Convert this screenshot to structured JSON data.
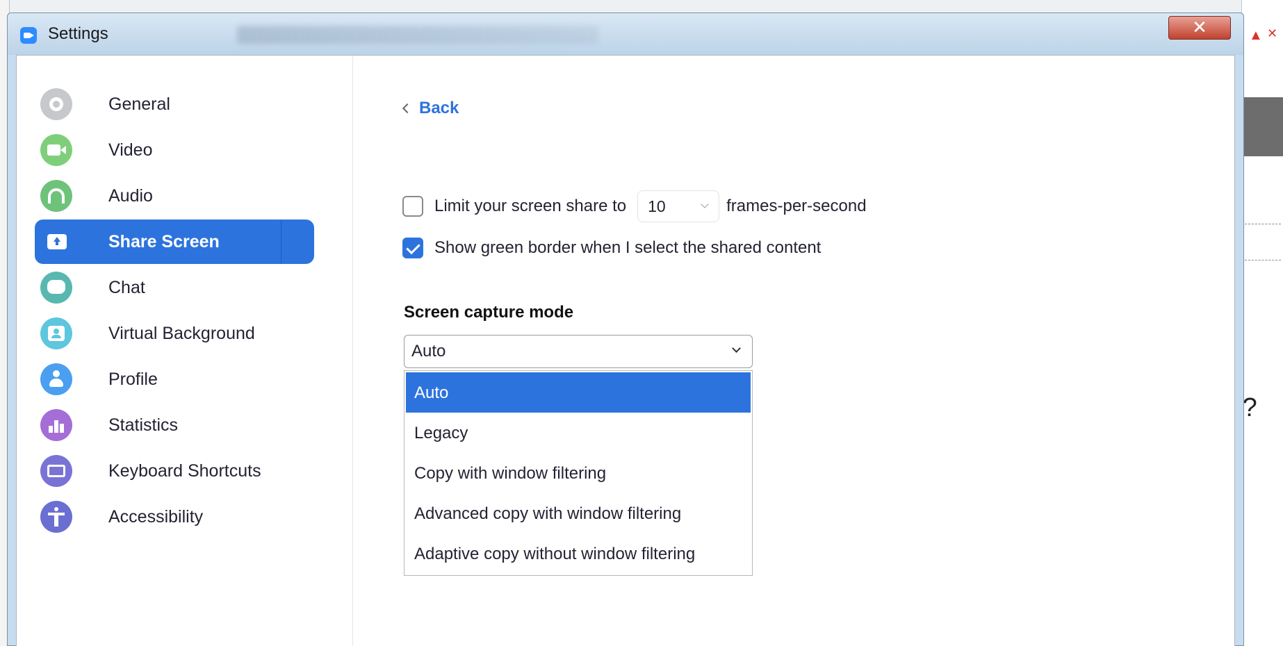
{
  "window": {
    "title": "Settings"
  },
  "sidebar": {
    "items": [
      {
        "label": "General",
        "icon": "gear-icon",
        "active": false
      },
      {
        "label": "Video",
        "icon": "video-camera-icon",
        "active": false
      },
      {
        "label": "Audio",
        "icon": "headphones-icon",
        "active": false
      },
      {
        "label": "Share Screen",
        "icon": "share-screen-icon",
        "active": true
      },
      {
        "label": "Chat",
        "icon": "chat-bubble-icon",
        "active": false
      },
      {
        "label": "Virtual Background",
        "icon": "virtual-background-icon",
        "active": false
      },
      {
        "label": "Profile",
        "icon": "profile-icon",
        "active": false
      },
      {
        "label": "Statistics",
        "icon": "bar-chart-icon",
        "active": false
      },
      {
        "label": "Keyboard Shortcuts",
        "icon": "keyboard-icon",
        "active": false
      },
      {
        "label": "Accessibility",
        "icon": "accessibility-icon",
        "active": false
      }
    ]
  },
  "content": {
    "back_label": "Back",
    "limit_fps": {
      "checked": false,
      "label_before": "Limit your screen share to",
      "value": "10",
      "label_after": "frames-per-second"
    },
    "green_border": {
      "checked": true,
      "label": "Show green border when I select the shared content"
    },
    "capture_mode": {
      "title": "Screen capture mode",
      "selected": "Auto",
      "options": [
        "Auto",
        "Legacy",
        "Copy with window filtering",
        "Advanced copy with window filtering",
        "Adaptive copy without window filtering"
      ]
    }
  },
  "background": {
    "partial_text": "r?"
  },
  "colors": {
    "accent": "#2d73de",
    "close_button": "#c2412e"
  }
}
